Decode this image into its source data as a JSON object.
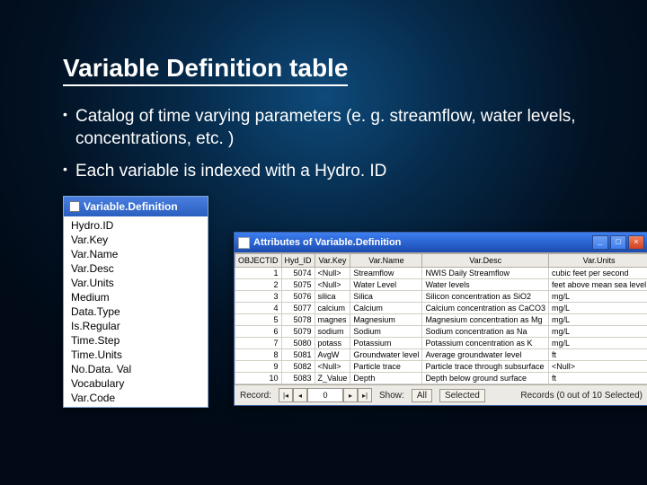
{
  "title": "Variable Definition table",
  "bullets": [
    "Catalog of time varying parameters (e. g. streamflow, water levels, concentrations, etc. )",
    "Each variable is indexed with a  Hydro. ID"
  ],
  "fieldlist": {
    "title": "Variable.Definition",
    "items": [
      "Hydro.ID",
      "Var.Key",
      "Var.Name",
      "Var.Desc",
      "Var.Units",
      "Medium",
      "Data.Type",
      "Is.Regular",
      "Time.Step",
      "Time.Units",
      "No.Data. Val",
      "Vocabulary",
      "Var.Code"
    ]
  },
  "attrwin": {
    "title": "Attributes of Variable.Definition",
    "columns": [
      "OBJECTID",
      "Hyd_ID",
      "Var.Key",
      "Var.Name",
      "Var.Desc",
      "Var.Units"
    ],
    "rows": [
      [
        "1",
        "5074",
        "<Null>",
        "Streamflow",
        "NWIS Daily Streamflow",
        "cubic feet per second"
      ],
      [
        "2",
        "5075",
        "<Null>",
        "Water Level",
        "Water levels",
        "feet above mean sea level"
      ],
      [
        "3",
        "5076",
        "silica",
        "Silica",
        "Silicon concentration as SiO2",
        "mg/L"
      ],
      [
        "4",
        "5077",
        "calcium",
        "Calcium",
        "Calcium concentration as CaCO3",
        "mg/L"
      ],
      [
        "5",
        "5078",
        "magnes",
        "Magnesium",
        "Magnesium concentration as Mg",
        "mg/L"
      ],
      [
        "6",
        "5079",
        "sodium",
        "Sodium",
        "Sodium concentration as Na",
        "mg/L"
      ],
      [
        "7",
        "5080",
        "potass",
        "Potassium",
        "Potassium concentration as K",
        "mg/L"
      ],
      [
        "8",
        "5081",
        "AvgW",
        "Groundwater level",
        "Average groundwater level",
        "ft"
      ],
      [
        "9",
        "5082",
        "<Null>",
        "Particle trace",
        "Particle trace through subsurface",
        "<Null>"
      ],
      [
        "10",
        "5083",
        "Z_Value",
        "Depth",
        "Depth below ground surface",
        "ft"
      ]
    ],
    "status": {
      "record_label": "Record:",
      "current": "0",
      "show_label": "Show:",
      "btn_all": "All",
      "btn_selected": "Selected",
      "count": "Records (0 out of 10 Selected)"
    }
  }
}
